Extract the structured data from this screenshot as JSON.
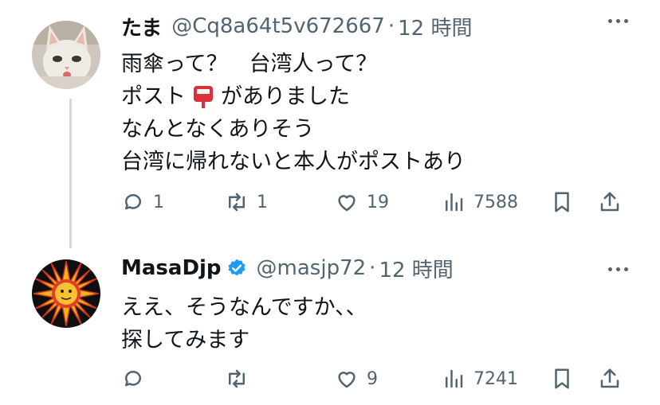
{
  "tweets": [
    {
      "name": "たま",
      "handle": "@Cq8a64t5v672667",
      "separator": "·",
      "time": "12 時間",
      "lines": [
        "雨傘って？　台湾人って？",
        "ポスト",
        "がありました",
        "なんとなくありそう",
        "台湾に帰れないと本人がポストあり"
      ],
      "replies": "1",
      "retweets": "1",
      "likes": "19",
      "views": "7588"
    },
    {
      "name": "MasaDjp",
      "handle": "@masjp72",
      "separator": "·",
      "time": "12 時間",
      "lines": [
        "ええ、そうなんですか、、",
        "探してみます"
      ],
      "replies": "",
      "retweets": "",
      "likes": "9",
      "views": "7241"
    }
  ],
  "icons": {
    "more": "more-horizontal-icon",
    "reply": "reply-icon",
    "retweet": "retweet-icon",
    "like": "heart-icon",
    "views": "views-icon",
    "bookmark": "bookmark-icon",
    "share": "share-icon",
    "verified": "verified-badge-icon",
    "mailbox": "mailbox-emoji"
  },
  "colors": {
    "text": "#0f1419",
    "secondary": "#536471",
    "verified": "#1d9bf0",
    "line": "#cfd9de"
  }
}
